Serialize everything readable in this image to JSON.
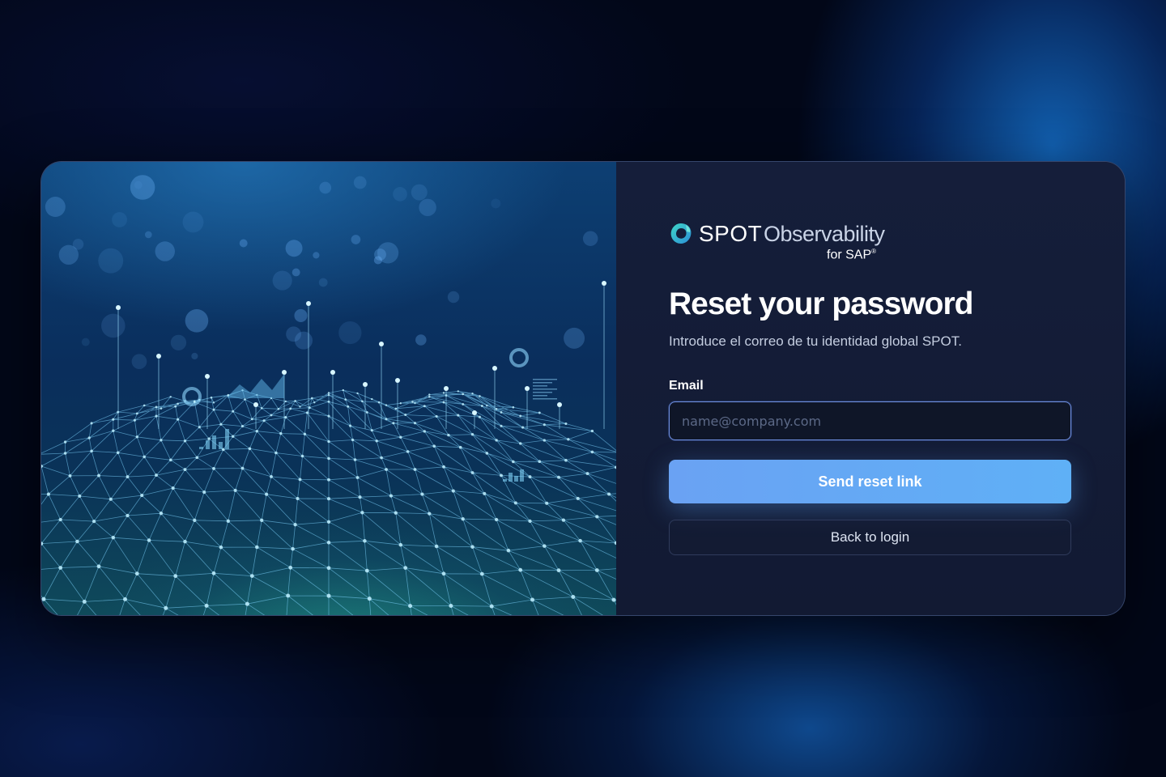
{
  "brand": {
    "name": "SPOT",
    "product": "Observability",
    "suffix": "for SAP",
    "registered": "®",
    "logo_icon": "spot-swirl-logo"
  },
  "form": {
    "title": "Reset your password",
    "subtitle": "Introduce el correo de tu identidad global SPOT.",
    "email_label": "Email",
    "email_placeholder": "name@company.com",
    "email_value": "",
    "submit_label": "Send reset link",
    "back_label": "Back to login"
  },
  "hero": {
    "image": "network-data-visualization",
    "description_icon": "digital-mesh-illustration"
  },
  "colors": {
    "primary_button": "#66a6f4",
    "card_background": "#131c36",
    "input_border": "#6f8fe0",
    "page_background": "#020718"
  }
}
